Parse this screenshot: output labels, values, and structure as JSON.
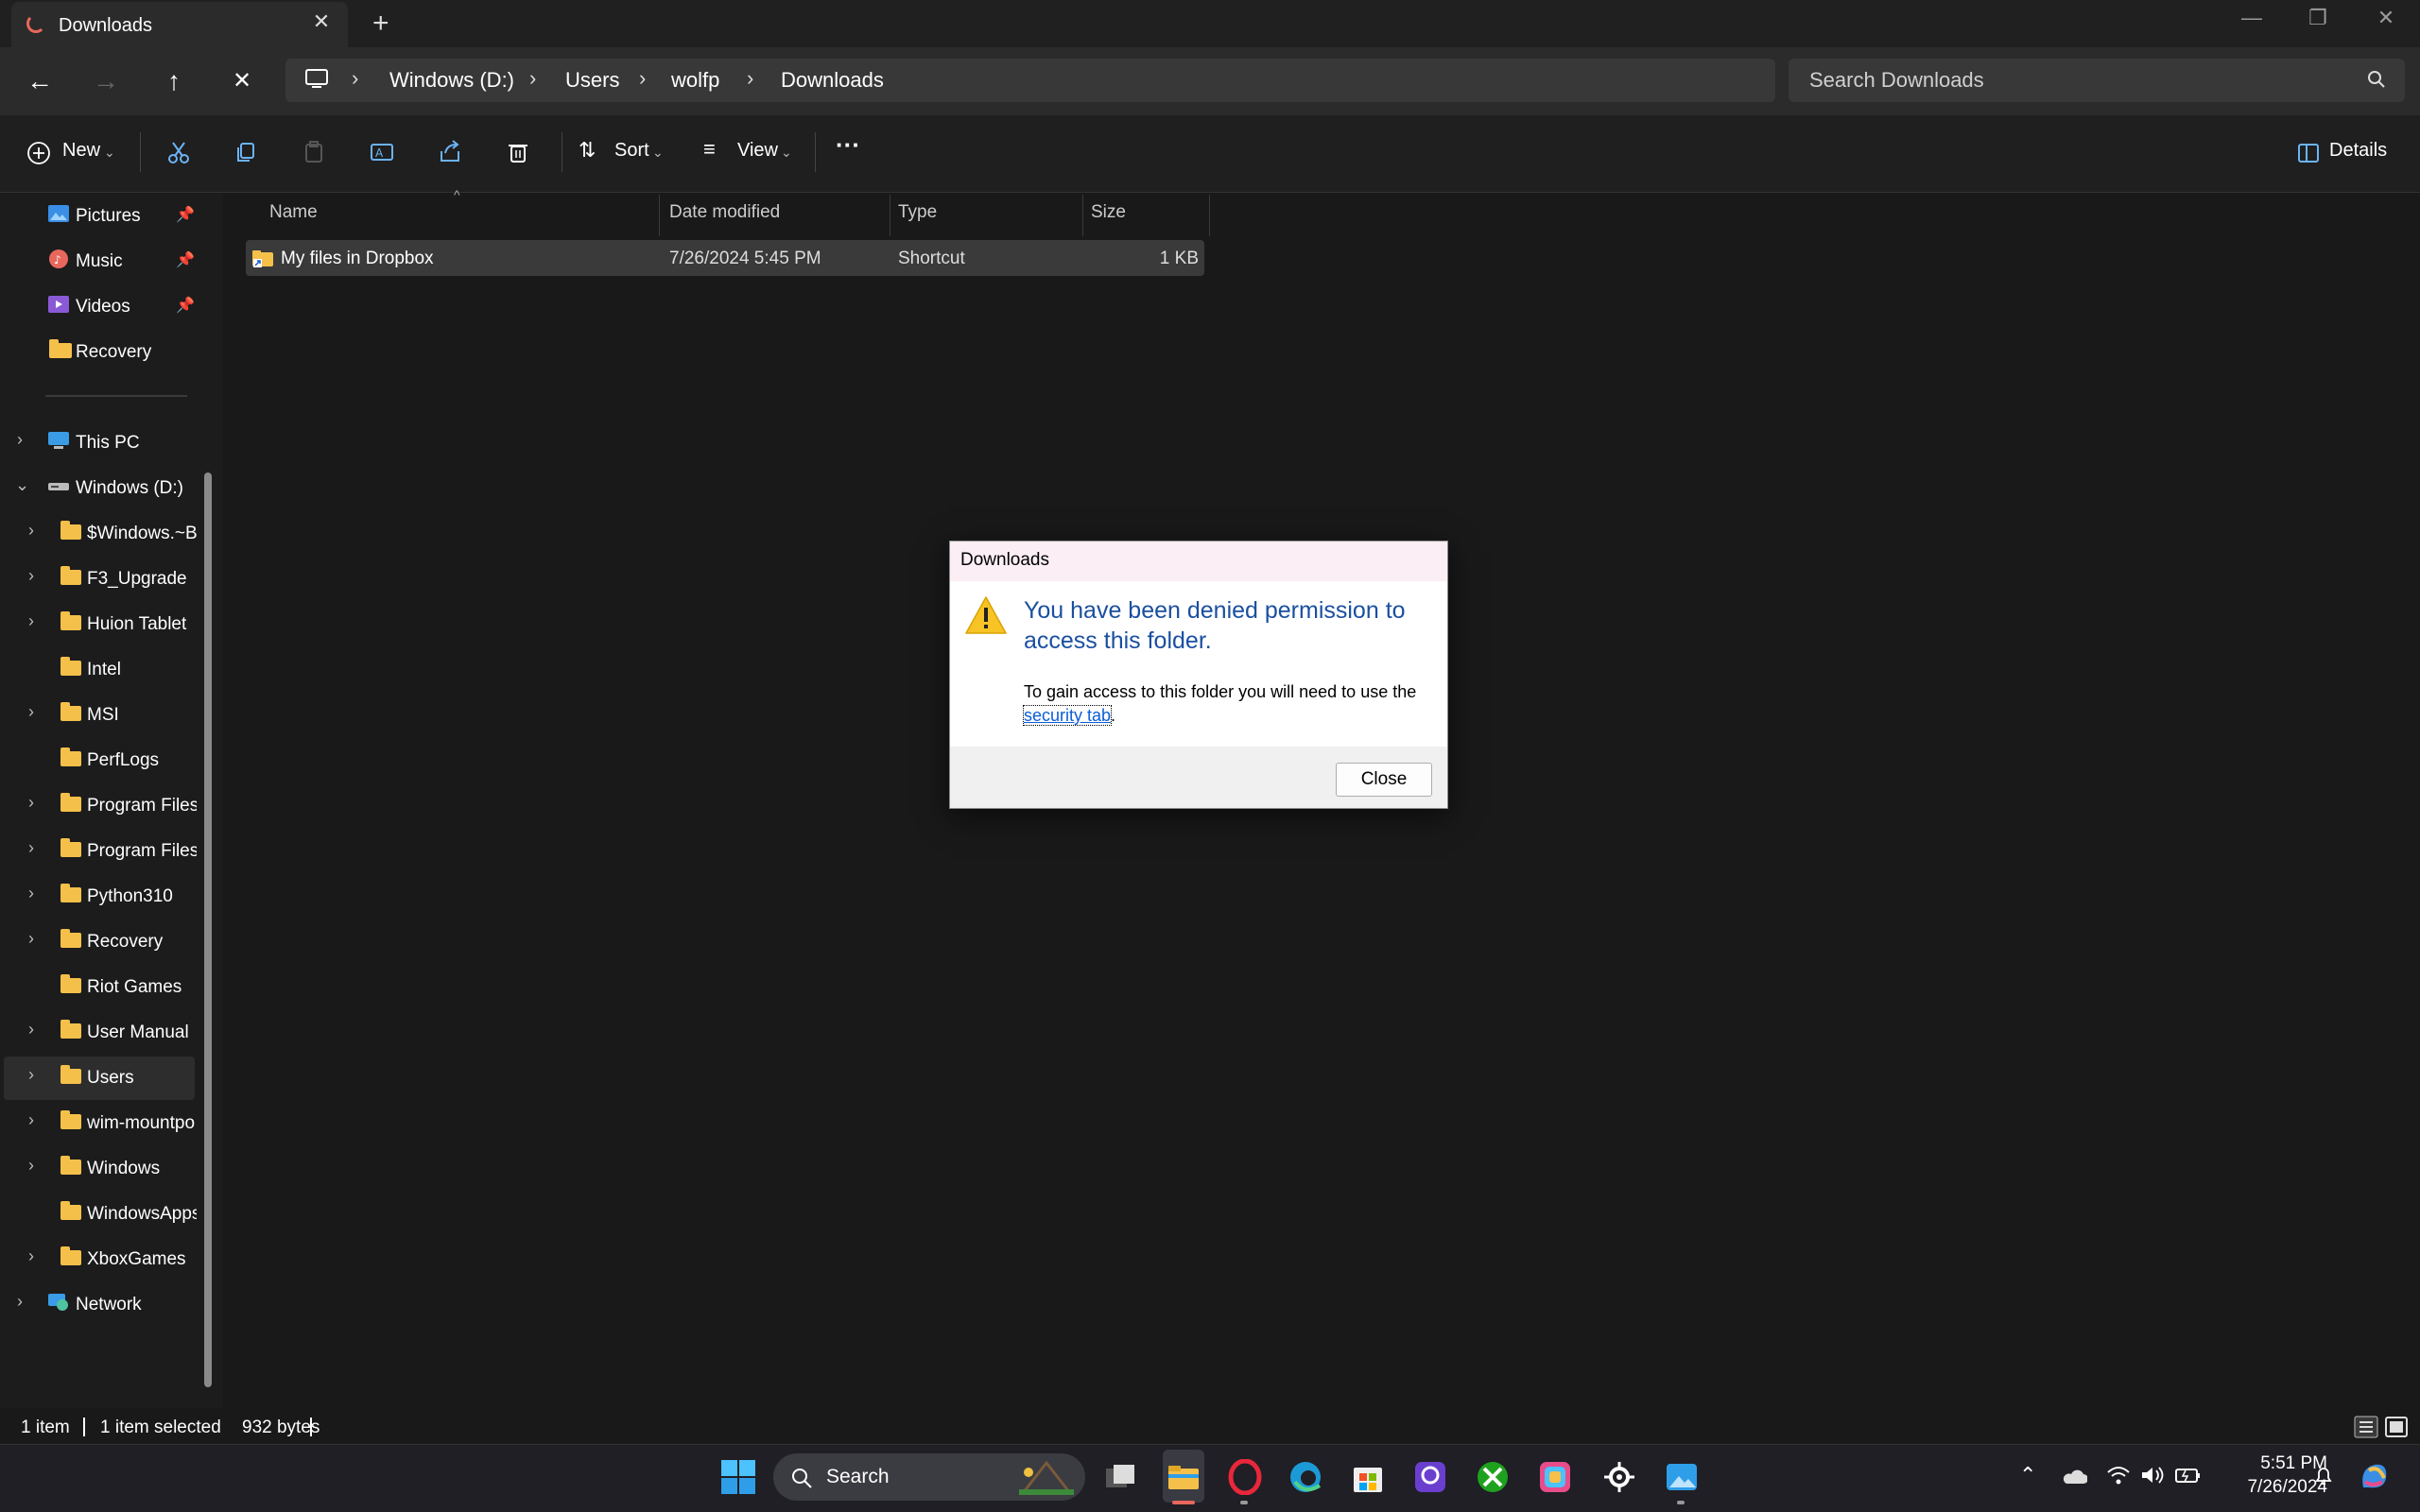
{
  "tab": {
    "title": "Downloads",
    "new_tab": "+",
    "close": "✕"
  },
  "window_controls": {
    "minimize": "—",
    "maximize": "❐",
    "close": "✕"
  },
  "nav": {
    "back": "←",
    "forward": "→",
    "up": "↑",
    "stop": "✕",
    "breadcrumb": [
      "Windows (D:)",
      "Users",
      "wolfp",
      "Downloads"
    ],
    "search_placeholder": "Search Downloads"
  },
  "toolbar": {
    "new": "New",
    "sort": "Sort",
    "view": "View",
    "more": "···",
    "details": "Details"
  },
  "sidebar": {
    "quick": [
      {
        "label": "Pictures",
        "pinned": true
      },
      {
        "label": "Music",
        "pinned": true
      },
      {
        "label": "Videos",
        "pinned": true
      },
      {
        "label": "Recovery",
        "pinned": false
      }
    ],
    "this_pc": "This PC",
    "drive": "Windows (D:)",
    "folders": [
      "$Windows.~BT",
      "F3_Upgrade",
      "Huion Tablet",
      "Intel",
      "MSI",
      "PerfLogs",
      "Program Files",
      "Program Files (",
      "Python310",
      "Recovery",
      "Riot Games",
      "User Manual",
      "Users",
      "wim-mountpo",
      "Windows",
      "WindowsApps",
      "XboxGames"
    ],
    "network": "Network"
  },
  "columns": {
    "name": "Name",
    "date": "Date modified",
    "type": "Type",
    "size": "Size"
  },
  "files": [
    {
      "name": "My files in Dropbox",
      "date": "7/26/2024 5:45 PM",
      "type": "Shortcut",
      "size": "1 KB"
    }
  ],
  "dialog": {
    "title": "Downloads",
    "heading": "You have been denied permission to access this folder.",
    "body_prefix": "To gain access to this folder you will need to use the ",
    "link": "security tab",
    "body_suffix": ".",
    "close": "Close"
  },
  "status": {
    "count": "1 item",
    "selected": "1 item selected",
    "bytes": "932 bytes"
  },
  "taskbar": {
    "search": "Search",
    "time": "5:51 PM",
    "date": "7/26/2024"
  }
}
